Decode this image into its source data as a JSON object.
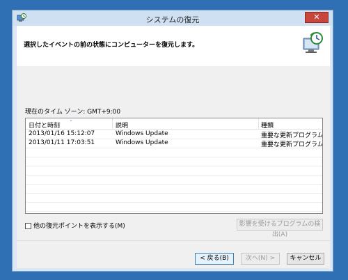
{
  "window": {
    "title": "システムの復元",
    "close_label": "✕"
  },
  "header": {
    "text": "選択したイベントの前の状態にコンピューターを復元します。"
  },
  "timezone": "現在のタイム ゾーン: GMT+9:00",
  "table": {
    "columns": [
      "日付と時刻",
      "説明",
      "種類"
    ],
    "rows": [
      [
        "2013/01/16 15:12:07",
        "Windows Update",
        "重要な更新プログラム"
      ],
      [
        "2013/01/11 17:03:51",
        "Windows Update",
        "重要な更新プログラム"
      ]
    ]
  },
  "options": {
    "show_more_label": "他の復元ポイントを表示する(M)",
    "scan_button": "影響を受けるプログラムの検出(A)"
  },
  "buttons": {
    "back": "< 戻る(B)",
    "next": "次へ(N) >",
    "cancel": "キャンセル"
  },
  "icons": {
    "app": "system-restore-icon",
    "header": "clock-computer-icon"
  }
}
